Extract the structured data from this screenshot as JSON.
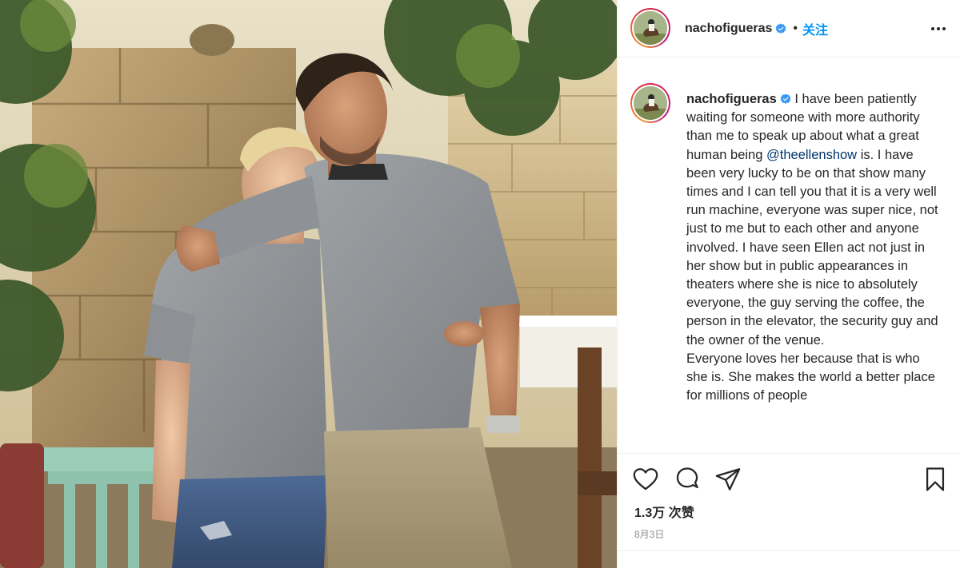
{
  "post": {
    "username": "nachofigueras",
    "follow_label": "关注",
    "separator": "•",
    "caption": {
      "part1": "I have been patiently waiting for someone with more authority than me to speak up about what a great human being",
      "mention": "@theellenshow",
      "part2": "is. I have been very lucky to be on that show many times and I can tell you that it is a very well run machine, everyone was super nice, not just to me but to each other and anyone involved. I have seen Ellen act not just in her show but in public appearances in theaters where she is nice to absolutely everyone, the guy serving the coffee, the person in the elevator, the security guy and the owner of the venue.",
      "part3": "Everyone loves her because that is who she is. She makes the world a better place for millions of people"
    },
    "likes": "1.3万 次赞",
    "date": "8月3日"
  },
  "icons": {
    "verified": "verified-badge-icon",
    "more": "more-options-icon",
    "like": "heart-icon",
    "comment": "comment-bubble-icon",
    "share": "paper-plane-icon",
    "save": "bookmark-icon"
  },
  "colors": {
    "accent": "#0095f6",
    "mention": "#00376b",
    "verified": "#3897f0",
    "muted": "#8e8e8e"
  }
}
